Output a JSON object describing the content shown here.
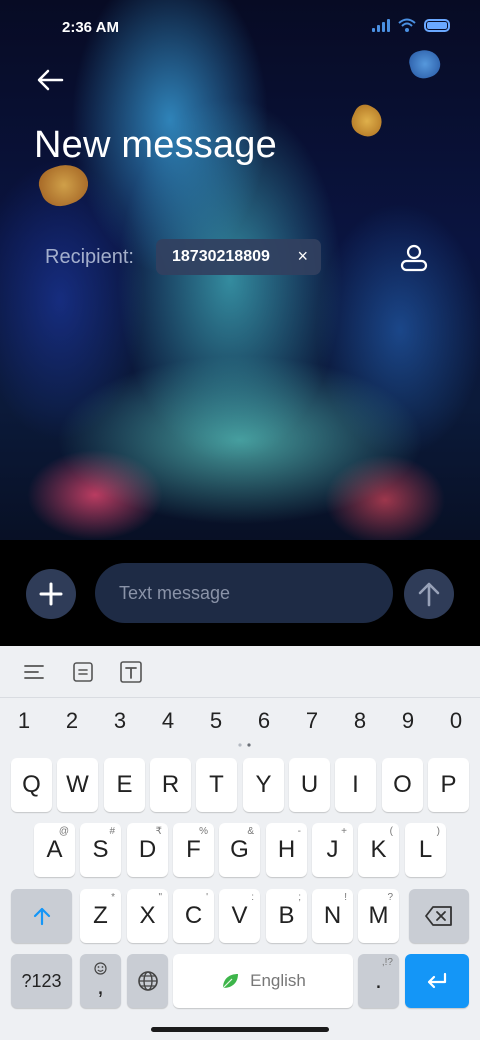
{
  "status_bar": {
    "time": "2:36 AM"
  },
  "header": {
    "title": "New message"
  },
  "recipient": {
    "label": "Recipient:",
    "number": "18730218809",
    "remove_glyph": "×"
  },
  "compose": {
    "placeholder": "Text message"
  },
  "keyboard": {
    "numbers": [
      "1",
      "2",
      "3",
      "4",
      "5",
      "6",
      "7",
      "8",
      "9",
      "0"
    ],
    "row1": [
      {
        "label": "Q"
      },
      {
        "label": "W"
      },
      {
        "label": "E"
      },
      {
        "label": "R"
      },
      {
        "label": "T"
      },
      {
        "label": "Y"
      },
      {
        "label": "U"
      },
      {
        "label": "I"
      },
      {
        "label": "O"
      },
      {
        "label": "P"
      }
    ],
    "row2": [
      {
        "label": "A",
        "sub": "@"
      },
      {
        "label": "S",
        "sub": "#"
      },
      {
        "label": "D",
        "sub": "₹"
      },
      {
        "label": "F",
        "sub": "%"
      },
      {
        "label": "G",
        "sub": "&"
      },
      {
        "label": "H",
        "sub": "-"
      },
      {
        "label": "J",
        "sub": "+"
      },
      {
        "label": "K",
        "sub": "("
      },
      {
        "label": "L",
        "sub": ")"
      }
    ],
    "row3": [
      {
        "label": "Z",
        "sub": "*"
      },
      {
        "label": "X",
        "sub": "\""
      },
      {
        "label": "C",
        "sub": "'"
      },
      {
        "label": "V",
        "sub": ":"
      },
      {
        "label": "B",
        "sub": ";"
      },
      {
        "label": "N",
        "sub": "!"
      },
      {
        "label": "M",
        "sub": "?"
      }
    ],
    "symbols_label": "?123",
    "comma_label": ",",
    "space_label": "English",
    "period_label": ".",
    "period_sub": ",!?"
  },
  "colors": {
    "accent": "#1496f7",
    "compose_field": "#1e2b45",
    "round_button": "#2f3c58"
  }
}
